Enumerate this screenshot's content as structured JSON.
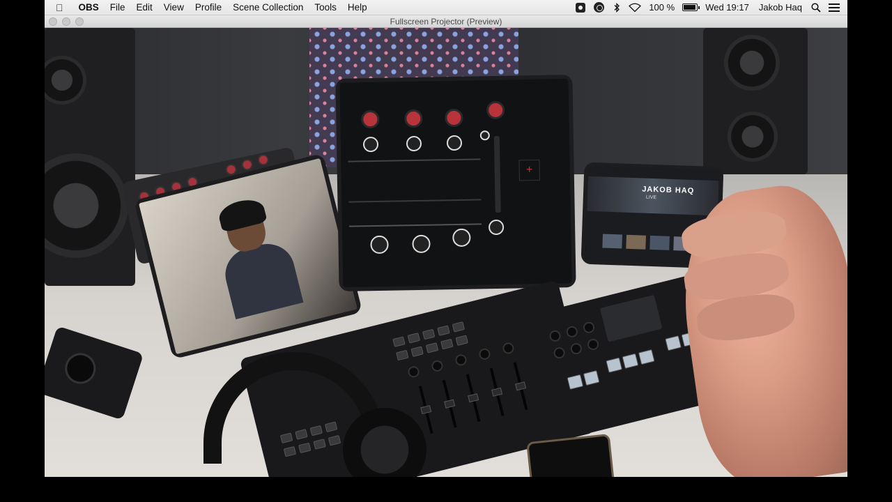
{
  "menubar": {
    "app_name": "OBS",
    "menus": [
      "File",
      "Edit",
      "View",
      "Profile",
      "Scene Collection",
      "Tools",
      "Help"
    ],
    "status_icons": [
      "screen-recorder-icon",
      "obs-status-icon",
      "bluetooth-icon",
      "wifi-icon"
    ],
    "battery_text": "100 %",
    "battery_level": 1.0,
    "clock": "Wed 19:17",
    "user_name": "Jakob Haq",
    "search_icon": "search-icon",
    "control_icon": "control-center-icon"
  },
  "window": {
    "title": "Fullscreen Projector (Preview)"
  },
  "preview": {
    "description_icon": "video-preview",
    "tablet_right_brand": "JAKOB HAQ",
    "tablet_right_sub": "LIVE"
  },
  "colors": {
    "menubar_bg": "#ececec",
    "titlebar_bg": "#dedede",
    "accent_red": "#b9343a"
  }
}
